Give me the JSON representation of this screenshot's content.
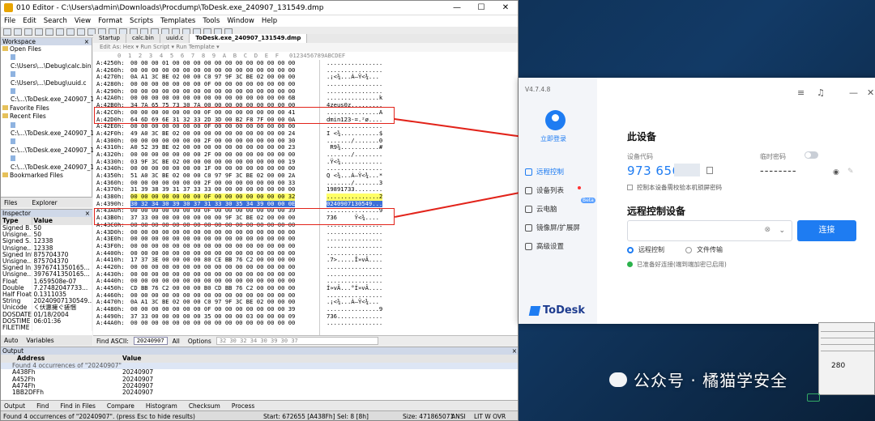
{
  "editor": {
    "title": "010 Editor - C:\\Users\\admin\\Downloads\\Procdump\\ToDesk.exe_240907_131549.dmp",
    "win_controls": [
      "—",
      "☐",
      "✕"
    ],
    "menu": [
      "File",
      "Edit",
      "Search",
      "View",
      "Format",
      "Scripts",
      "Templates",
      "Tools",
      "Window",
      "Help"
    ],
    "workspace": {
      "title": "Workspace",
      "open_files": "Open Files",
      "open_items": [
        "C:\\Users\\...\\Debug\\calc.bin",
        "C:\\Users\\...\\Debug\\uuid.c",
        "C:\\...\\ToDesk.exe_240907_13"
      ],
      "favorite": "Favorite Files",
      "recent": "Recent Files",
      "recent_items": [
        "C:\\...\\ToDesk.exe_240907_12",
        "C:\\...\\ToDesk.exe_240907_13",
        "C:\\...\\ToDesk.exe_240907_11"
      ],
      "bookmarked": "Bookmarked Files",
      "tabs": [
        "Files",
        "Explorer"
      ]
    },
    "inspector": {
      "title": "Inspector",
      "col_type": "Type",
      "col_value": "Value",
      "rows": [
        [
          "Signed B...",
          "50"
        ],
        [
          "Unsigne...",
          "50"
        ],
        [
          "Signed S...",
          "12338"
        ],
        [
          "Unsigne...",
          "12338"
        ],
        [
          "Signed Int",
          "875704370"
        ],
        [
          "Unsigne...",
          "875704370"
        ],
        [
          "Signed In...",
          "3976741350165..."
        ],
        [
          "Unsigne...",
          "3976741350165..."
        ],
        [
          "Float",
          "1.659508e-07"
        ],
        [
          "Double",
          "7.27482047733..."
        ],
        [
          "Half Float",
          "0.1311035"
        ],
        [
          "String",
          "20240907130549..."
        ],
        [
          "Unicode",
          "く伏惠擁ぐ搓悃"
        ],
        [
          "DOSDATE",
          "01/18/2004"
        ],
        [
          "DOSTIME",
          "06:01:36"
        ],
        [
          "FILETIME",
          ""
        ]
      ],
      "tabs": [
        "Auto",
        "Variables"
      ]
    },
    "file_tabs": [
      "Startup",
      "calc.bin",
      "uuid.c",
      "ToDesk.exe_240907_131549.dmp"
    ],
    "subtoolbar": "Edit As: Hex ▾   Run Script ▾   Run Template ▾",
    "col_header": "      0  1  2  3  4  5  6  7  8  9  A  B  C  D  E  F   0123456789ABCDEF",
    "rows": [
      [
        "A:4250h:",
        "00 00 00 01 00 00 00 00 00 00 00 00 00 00 00 00",
        "................",
        ""
      ],
      [
        "A:4260h:",
        "00 00 00 00 00 00 00 00 00 00 00 00 00 00 00 00",
        "................",
        ""
      ],
      [
        "A:4270h:",
        "0A A1 3C BE 02 00 00 C0 97 9F 3C BE 02 00 00 00",
        ".¡<¾...À—Ÿ<¾...",
        ""
      ],
      [
        "A:4280h:",
        "00 00 00 00 00 00 00 0F 00 00 00 00 00 00 00 00",
        "................",
        ""
      ],
      [
        "A:4290h:",
        "00 00 00 00 00 00 00 00 00 00 00 00 00 00 00 00",
        "................",
        ""
      ],
      [
        "A:42A0h:",
        "00 00 00 00 00 00 00 00 00 00 00 00 00 00 00 6B",
        "...............k",
        ""
      ],
      [
        "A:42B0h:",
        "34 7A 65 75 73 30 7A 00 00 00 00 00 00 00 00 00",
        "4zeus0z.........",
        ""
      ],
      [
        "A:42C0h:",
        "00 00 00 00 00 00 00 0F 00 00 00 00 00 00 00 41",
        "...............A",
        ""
      ],
      [
        "A:42D0h:",
        "64 6D 69 6E 31 32 33 2D 3D 00 B2 F8 7F 00 00 0A",
        "dmin123-=.²ø....",
        ""
      ],
      [
        "A:42E0h:",
        "00 00 00 00 00 00 00 0F 00 00 00 00 00 00 00 00",
        "................",
        ""
      ],
      [
        "A:42F0h:",
        "49 A0 3C BE 02 00 00 00 00 00 00 00 00 00 00 24",
        "I <¾...........$",
        ""
      ],
      [
        "A:4300h:",
        "00 00 00 00 00 00 00 2F 00 00 00 00 00 00 00 30",
        "......./.......0",
        ""
      ],
      [
        "A:4310h:",
        "A0 52 39 BE 02 00 00 00 00 00 00 00 00 00 00 23",
        " R9¾...........#",
        ""
      ],
      [
        "A:4320h:",
        "00 00 00 00 00 00 00 2F 00 00 00 00 00 00 00 00",
        "......./........",
        ""
      ],
      [
        "A:4330h:",
        "03 9F 3C BE 02 00 00 00 00 00 00 00 00 00 00 19",
        ".Ÿ<¾............",
        ""
      ],
      [
        "A:4340h:",
        "00 00 00 00 00 00 00 1F 00 00 00 00 00 00 00 00",
        "................",
        ""
      ],
      [
        "A:4350h:",
        "51 A0 3C BE 02 00 00 C0 97 9F 3C BE 02 00 00 2A",
        "Q <¾...À—Ÿ<¾...*",
        ""
      ],
      [
        "A:4360h:",
        "00 00 00 00 00 00 00 2F 00 00 00 00 00 00 00 33",
        "......./.......3",
        ""
      ],
      [
        "A:4370h:",
        "31 39 38 39 31 37 33 33 00 00 00 00 00 00 00 00",
        "19891733........",
        ""
      ],
      [
        "A:4380h:",
        "00 00 00 00 00 00 00 0F 00 00 00 00 00 00 00 32",
        "...............2",
        "yel"
      ],
      [
        "A:4390h:",
        "30 32 34 30 39 30 37 31 33 30 35 34 39 00 00 0E",
        "0240907130549...",
        "sel"
      ],
      [
        "A:43A0h:",
        "00 00 00 00 00 00 00 0F 00 00 00 00 00 00 00 39",
        "...............9",
        ""
      ],
      [
        "A:43B0h:",
        "37 33 00 00 00 00 00 00 00 9F 3C BE 02 00 00 00",
        "736     Ÿ<¾....",
        ""
      ],
      [
        "A:43C0h:",
        "00 00 00 00 00 00 00 00 00 00 00 00 00 00 00 00",
        "................",
        ""
      ],
      [
        "A:43D0h:",
        "00 00 00 00 00 00 00 00 00 00 00 00 00 00 00 00",
        "................",
        ""
      ],
      [
        "A:43E0h:",
        "00 00 00 00 00 00 00 00 00 00 00 00 00 00 00 00",
        "................",
        ""
      ],
      [
        "A:43F0h:",
        "00 00 00 00 00 00 00 00 00 00 00 00 00 00 00 00",
        "................",
        ""
      ],
      [
        "A:4400h:",
        "00 00 00 00 00 00 00 00 00 00 00 00 00 00 00 00",
        "................",
        ""
      ],
      [
        "A:4410h:",
        "17 37 3E 00 00 00 00 80 CE BB 76 C2 00 00 00 00",
        ".7>.....Î»vÂ....",
        ""
      ],
      [
        "A:4420h:",
        "00 00 00 00 00 00 00 00 00 00 00 00 00 00 00 00",
        "................",
        ""
      ],
      [
        "A:4430h:",
        "00 00 00 00 00 00 00 00 00 00 00 00 00 00 00 00",
        "................",
        ""
      ],
      [
        "A:4440h:",
        "00 00 00 00 00 00 00 00 00 00 00 00 00 00 00 00",
        "................",
        ""
      ],
      [
        "A:4450h:",
        "CD BB 76 C2 00 00 00 B0 CD BB 76 C2 00 00 00 00",
        "Í»vÂ...°Í»vÂ....",
        ""
      ],
      [
        "A:4460h:",
        "00 00 00 00 00 00 00 00 00 00 00 00 00 00 00 00",
        "................",
        ""
      ],
      [
        "A:4470h:",
        "0A A1 3C BE 02 00 00 C0 97 9F 3C BE 02 00 00 00",
        ".¡<¾...À—Ÿ<¾...",
        ""
      ],
      [
        "A:4480h:",
        "00 00 00 00 00 00 00 0F 00 00 00 00 00 00 00 39",
        "...............9",
        ""
      ],
      [
        "A:4490h:",
        "37 33 00 00 00 00 00 35 00 00 00 03 00 00 00 09",
        "736.............",
        ""
      ],
      [
        "A:44A0h:",
        "00 00 00 00 00 00 00 00 00 00 00 00 00 00 00 00",
        "................",
        ""
      ]
    ],
    "find": {
      "label": "Find ASCII:",
      "value": "20240907",
      "all": "All",
      "options": "Options",
      "hex": "32 30 32 34 30 39 30 37"
    },
    "output": {
      "title": "Output",
      "col_addr": "Address",
      "col_val": "Value",
      "rows": [
        [
          "Found 4 occurrences of \"20240907\"",
          ""
        ],
        [
          "A438Fh",
          "20240907"
        ],
        [
          "A452Fh",
          "20240907"
        ],
        [
          "A474Fh",
          "20240907"
        ],
        [
          "1BB2DFFh",
          "20240907"
        ]
      ],
      "tabs": [
        "Output",
        "Find",
        "Find in Files",
        "Compare",
        "Histogram",
        "Checksum",
        "Process"
      ]
    },
    "status": {
      "left": "Found 4 occurrences of \"20240907\". (press Esc to hide results)",
      "start": "Start: 672655 [A438Fh] Sel: 8 [8h]",
      "size": "Size: 471865071",
      "enc": "ANSI",
      "mode": "LIT  W  OVR"
    }
  },
  "todesk": {
    "version": "V4.7.4.8",
    "login": "立即登录",
    "menu": [
      "远程控制",
      "设备列表",
      "云电脑",
      "镜像屏/扩展屏",
      "高级设置"
    ],
    "beta": "Beta",
    "brand": "ToDesk",
    "this_device": "此设备",
    "code_label": "设备代码",
    "code_value": "973 656",
    "pwd_label": "临时密码",
    "pwd_value": "--------",
    "lock_option": "控制本设备需校验本机锁屏密码",
    "remote_title": "远程控制设备",
    "connect": "连接",
    "radio_control": "远程控制",
    "radio_file": "文件传输",
    "ready": "已准备好连接(端到端加密已启用)"
  },
  "watermark": "公众号 · 橘猫学安全",
  "tray_clock": "280"
}
